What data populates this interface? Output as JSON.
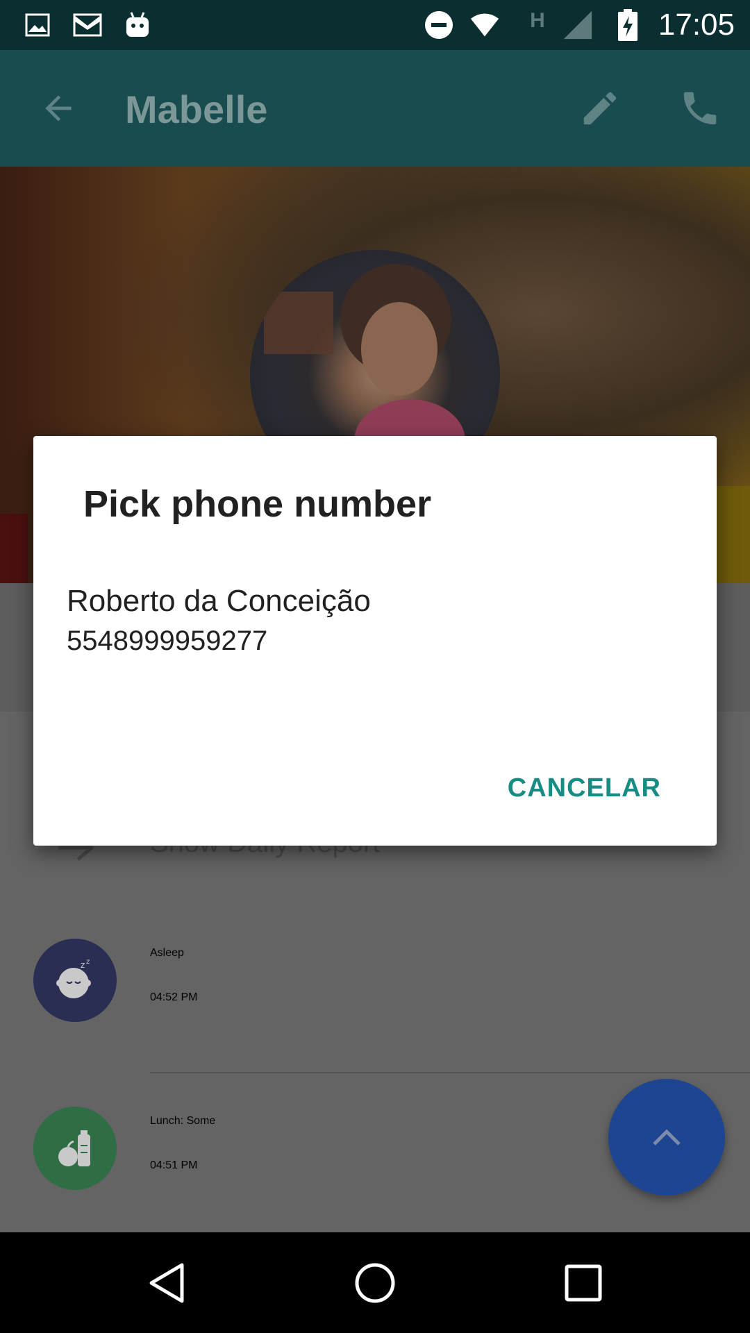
{
  "status_bar": {
    "time": "17:05",
    "network_type": "H",
    "icons": [
      "image-icon",
      "gmail-icon",
      "android-icon",
      "do-not-disturb-icon",
      "wifi-icon",
      "cell-signal-icon",
      "battery-charging-icon"
    ]
  },
  "app_bar": {
    "title": "Mabelle",
    "icons": [
      "back-arrow-icon",
      "edit-pencil-icon",
      "phone-call-icon"
    ]
  },
  "background_list": {
    "behind_dialog_text": "Show Daily Report",
    "items": [
      {
        "title": "Asleep",
        "time": "04:52 PM",
        "icon": "sleeping-baby-icon",
        "color": "#2a2e52"
      },
      {
        "title": "Lunch: Some",
        "time": "04:51 PM",
        "icon": "food-bottle-icon",
        "color": "#2f6d44"
      }
    ]
  },
  "fab": {
    "icon": "chevron-up-icon",
    "color": "#1d4592"
  },
  "dialog": {
    "title": "Pick phone number",
    "items": [
      {
        "name": "Roberto da Conceição",
        "number": "5548999959277"
      }
    ],
    "cancel_label": "CANCELAR",
    "accent_color": "#168c82"
  },
  "nav_bar": {
    "icons": [
      "nav-back-icon",
      "nav-home-icon",
      "nav-recents-icon"
    ]
  }
}
